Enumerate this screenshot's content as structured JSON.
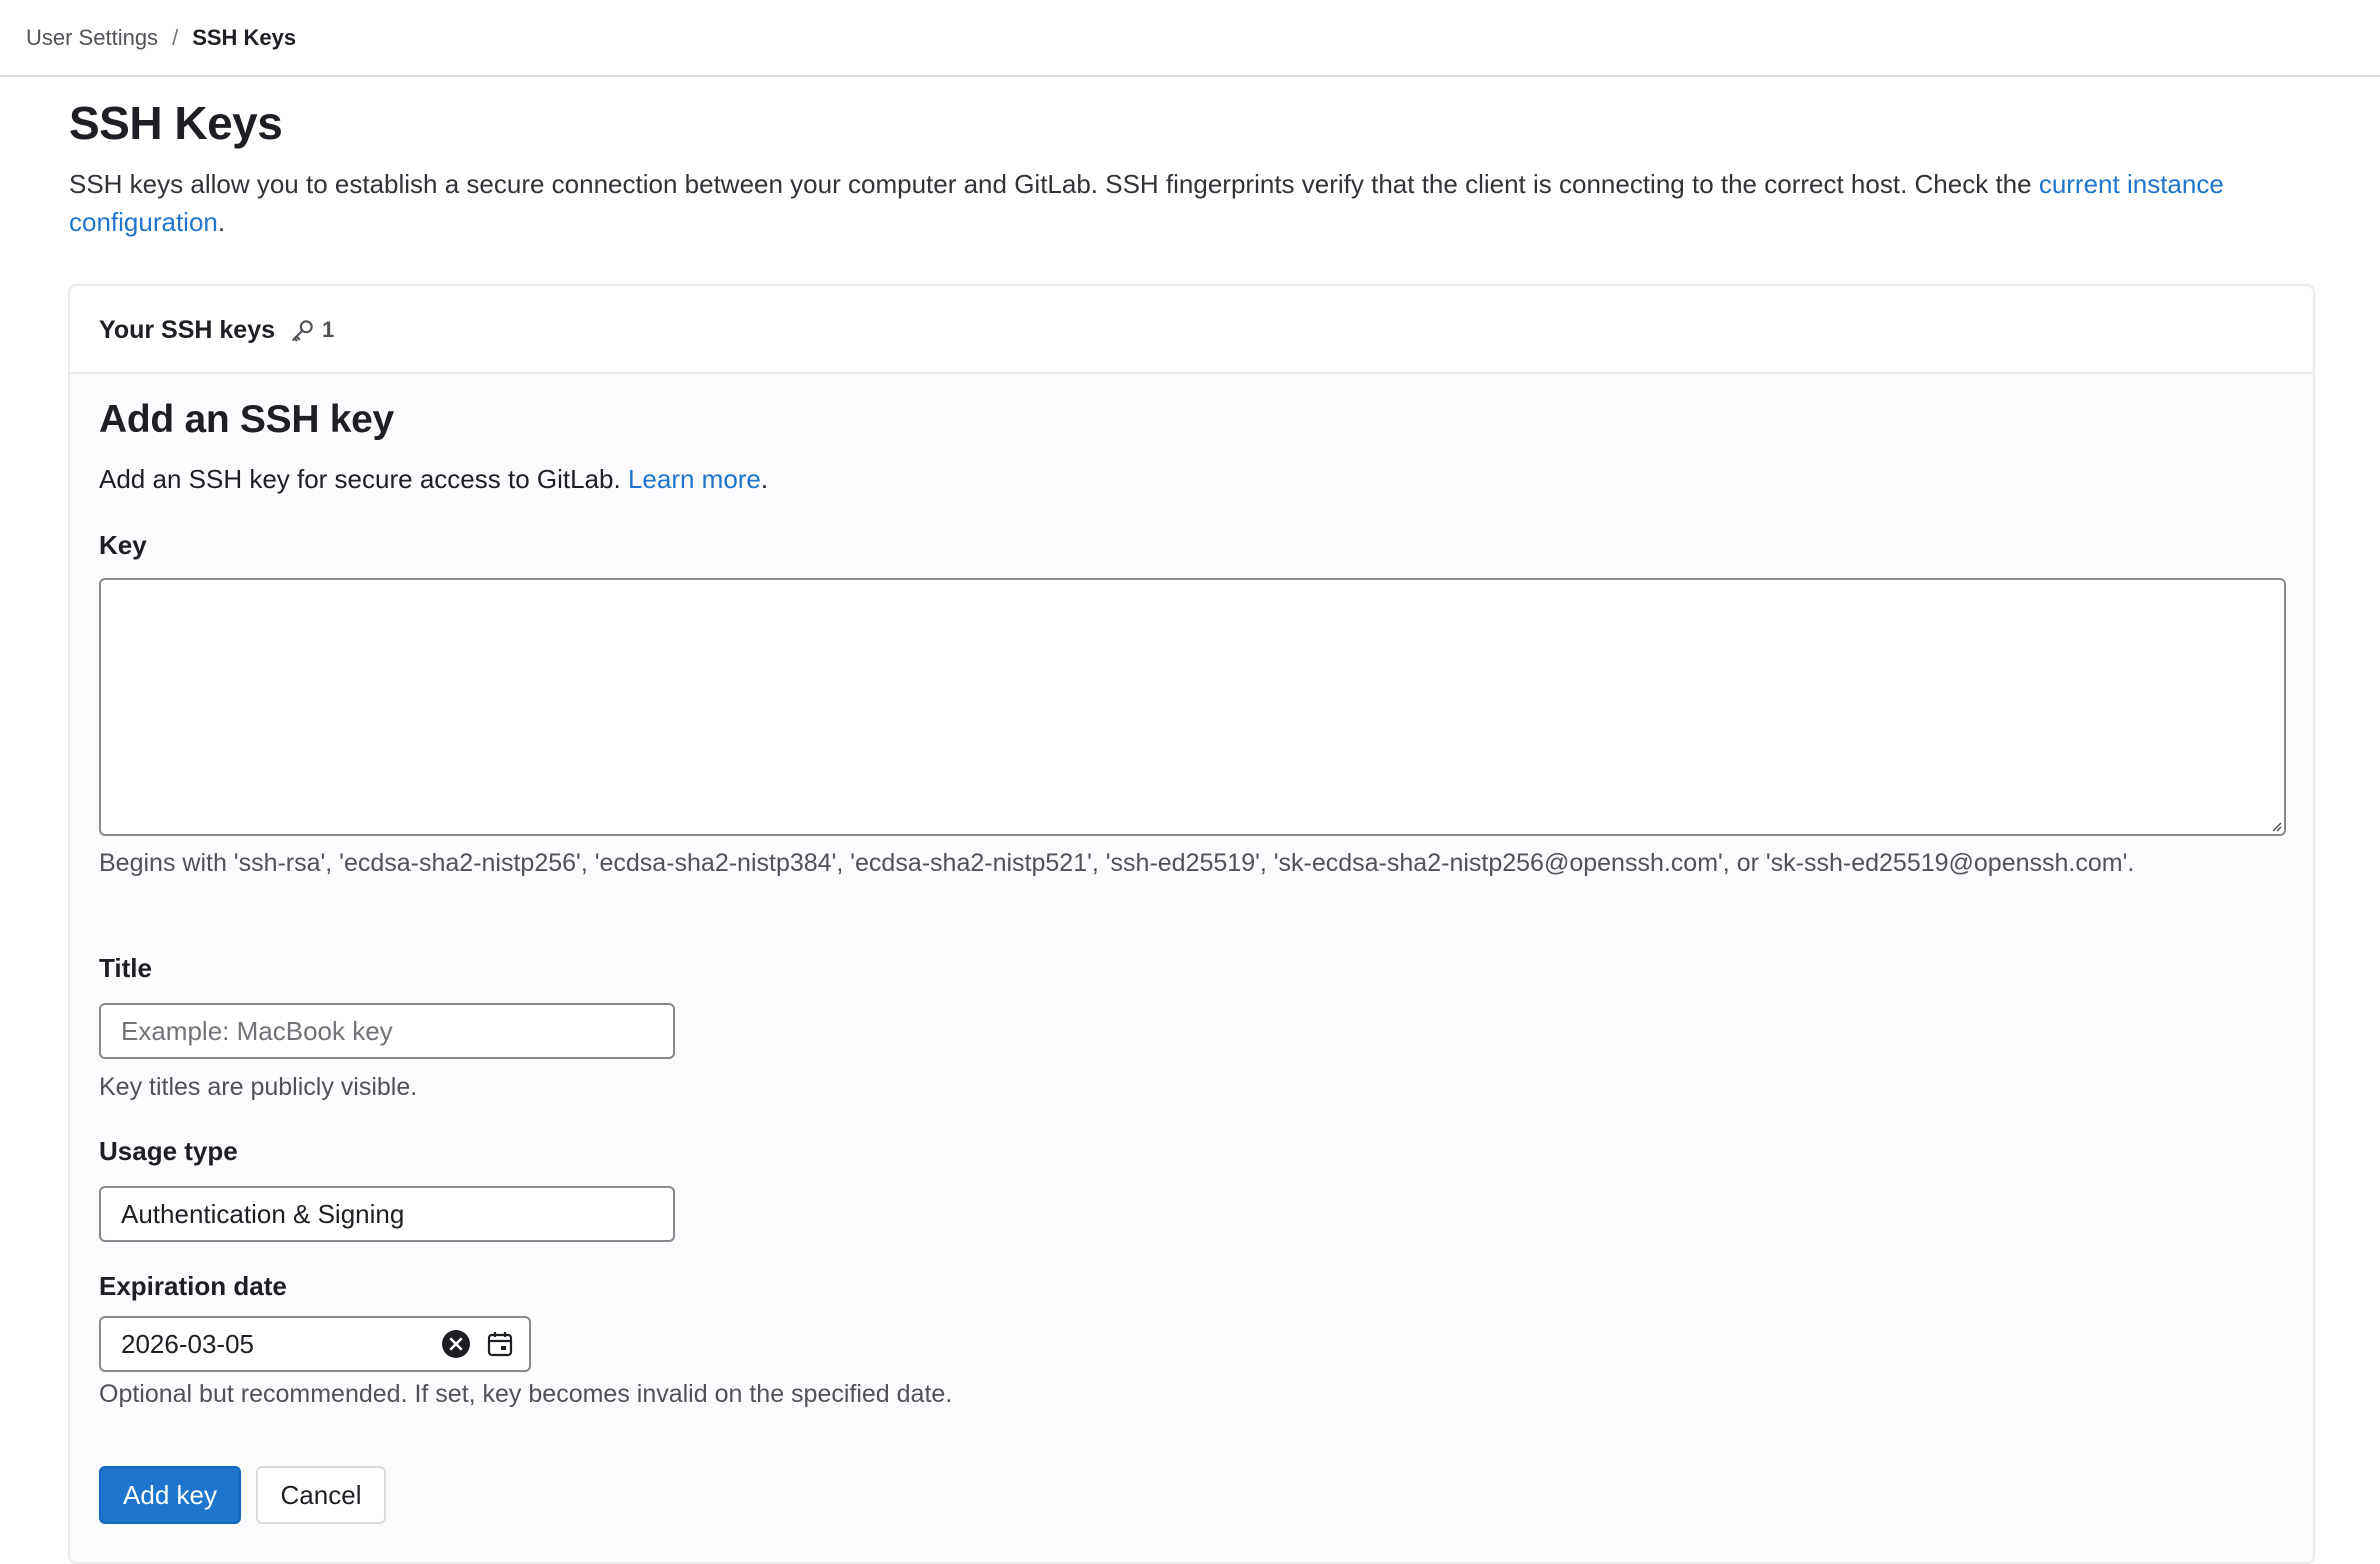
{
  "breadcrumb": {
    "parent": "User Settings",
    "separator": "/",
    "current": "SSH Keys"
  },
  "page": {
    "title": "SSH Keys",
    "description": "SSH keys allow you to establish a secure connection between your computer and GitLab. SSH fingerprints verify that the client is connecting to the correct host. Check the ",
    "description_link": "current instance configuration",
    "description_end": "."
  },
  "card": {
    "header_title": "Your SSH keys",
    "key_icon": "key-icon",
    "key_count": "1"
  },
  "form": {
    "title": "Add an SSH key",
    "description": "Add an SSH key for secure access to GitLab. ",
    "description_link": "Learn more",
    "description_end": ".",
    "key": {
      "label": "Key",
      "value": "",
      "help": "Begins with 'ssh-rsa', 'ecdsa-sha2-nistp256', 'ecdsa-sha2-nistp384', 'ecdsa-sha2-nistp521', 'ssh-ed25519', 'sk-ecdsa-sha2-nistp256@openssh.com', or 'sk-ssh-ed25519@openssh.com'."
    },
    "title_field": {
      "label": "Title",
      "value": "",
      "placeholder": "Example: MacBook key",
      "help": "Key titles are publicly visible."
    },
    "usage_type": {
      "label": "Usage type",
      "selected": "Authentication & Signing"
    },
    "expiration": {
      "label": "Expiration date",
      "value": "2026-03-05",
      "clear_icon": "clear-circle-icon",
      "calendar_icon": "calendar-icon",
      "help": "Optional but recommended. If set, key becomes invalid on the specified date."
    },
    "submit_label": "Add key",
    "cancel_label": "Cancel"
  },
  "colors": {
    "link": "#1f75cb",
    "primary_button": "#1f75cb",
    "card_background": "#fbfafd",
    "border": "#89888d"
  }
}
